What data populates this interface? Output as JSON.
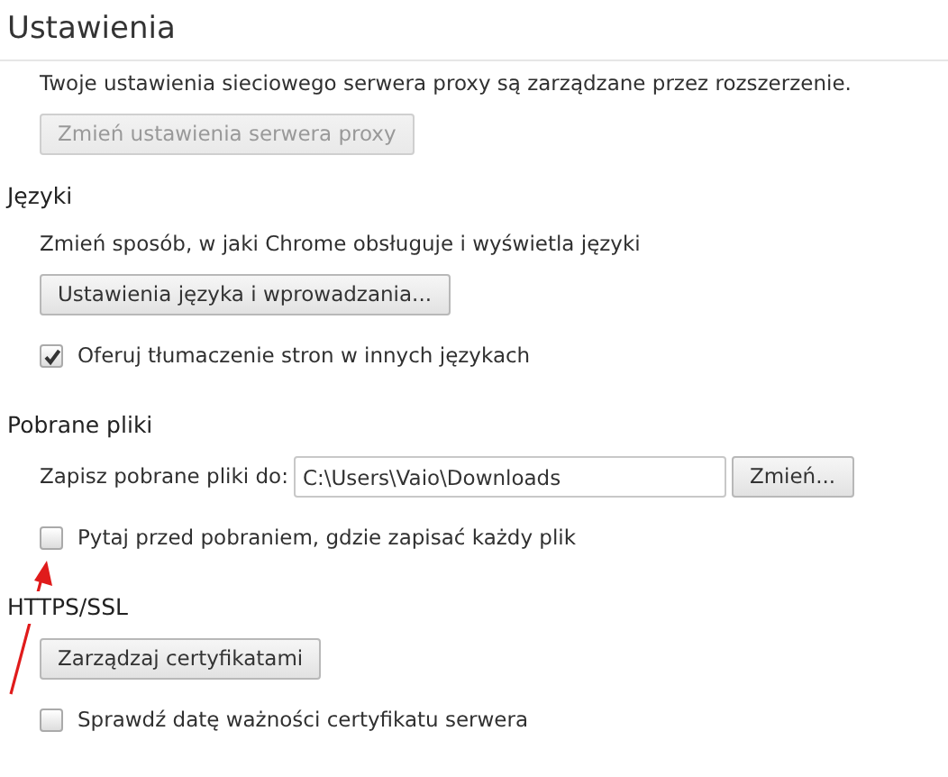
{
  "header": {
    "title": "Ustawienia"
  },
  "sections": [
    {
      "items": [
        {
          "kind": "text",
          "text": "Twoje ustawienia sieciowego serwera proxy są zarządzane przez rozszerzenie."
        },
        {
          "kind": "button",
          "label": "Zmień ustawienia serwera proxy",
          "disabled": true
        }
      ]
    },
    {
      "heading": "Języki",
      "items": [
        {
          "kind": "text",
          "text": "Zmień sposób, w jaki Chrome obsługuje i wyświetla języki"
        },
        {
          "kind": "button",
          "label": "Ustawienia języka i wprowadzania...",
          "disabled": false
        },
        {
          "kind": "checkbox",
          "label": "Oferuj tłumaczenie stron w innych językach",
          "checked": true
        }
      ]
    },
    {
      "heading": "Pobrane pliki",
      "items": [
        {
          "kind": "path",
          "label": "Zapisz pobrane pliki do:",
          "value": "C:\\Users\\Vaio\\Downloads",
          "button": "Zmień..."
        },
        {
          "kind": "checkbox",
          "label": "Pytaj przed pobraniem, gdzie zapisać każdy plik",
          "checked": false
        }
      ]
    },
    {
      "heading": "HTTPS/SSL",
      "items": [
        {
          "kind": "button",
          "label": "Zarządzaj certyfikatami",
          "disabled": false
        },
        {
          "kind": "checkbox",
          "label": "Sprawdź datę ważności certyfikatu serwera",
          "checked": false
        }
      ]
    }
  ],
  "annotation": {
    "kind": "arrow"
  }
}
